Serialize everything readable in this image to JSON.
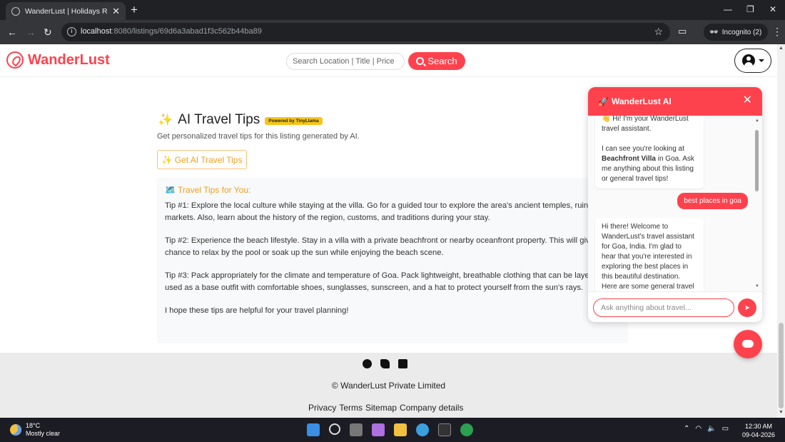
{
  "browser": {
    "tab_title": "WanderLust | Holidays Rentals",
    "url_host": "localhost",
    "url_path": ":8080/listings/69d6a3abad1f3c562b44ba89",
    "incognito_label": "Incognito (2)"
  },
  "navbar": {
    "brand": "WanderLust",
    "search_placeholder": "Search Location | Title | Price",
    "search_label": "Search"
  },
  "ai_tips": {
    "title": "AI Travel Tips",
    "badge": "Powered by TinyLlama",
    "subtitle": "Get personalized travel tips for this listing generated by AI.",
    "button_label": "✨ Get AI Travel Tips",
    "tips_heading": "🗺️ Travel Tips for You:",
    "tips": [
      "Tip #1: Explore the local culture while staying at the villa. Go for a guided tour to explore the area's ancient temples, ruins, and markets. Also, learn about the history of the region, customs, and traditions during your stay.",
      "Tip #2: Experience the beach lifestyle. Stay in a villa with a private beachfront or nearby oceanfront property. This will give you the chance to relax by the pool or soak up the sun while enjoying the beach scene.",
      "Tip #3: Pack appropriately for the climate and temperature of Goa. Pack lightweight, breathable clothing that can be layered or used as a base outfit with comfortable shoes, sunglasses, sunscreen, and a hat to protect yourself from the sun's rays.",
      "I hope these tips are helpful for your travel planning!"
    ]
  },
  "footer": {
    "copyright": "© WanderLust Private Limited",
    "links": [
      "Privacy",
      "Terms",
      "Sitemap",
      "Company details"
    ]
  },
  "chat": {
    "title": "WanderLust AI",
    "msg1_line1": "👋 Hi! I'm your WanderLust travel assistant.",
    "msg1_pre": "I can see you're looking at ",
    "msg1_listing": "Beachfront Villa",
    "msg1_post": " in Goa. Ask me anything about this listing or general travel tips!",
    "user_msg": "best places in goa",
    "bot_reply": "Hi there! Welcome to WanderLust's travel assistant for Goa, India. I'm glad to hear that you're interested in exploring the best places in this beautiful destination. Here are some general travel questions you might",
    "input_placeholder": "Ask anything about travel..."
  },
  "taskbar": {
    "temp": "18°C",
    "condition": "Mostly clear",
    "time": "12:30 AM",
    "date": "09-04-2026"
  },
  "colors": {
    "brand": "#fe424d",
    "badge": "#f5c518",
    "tips_accent": "#f0a020"
  }
}
